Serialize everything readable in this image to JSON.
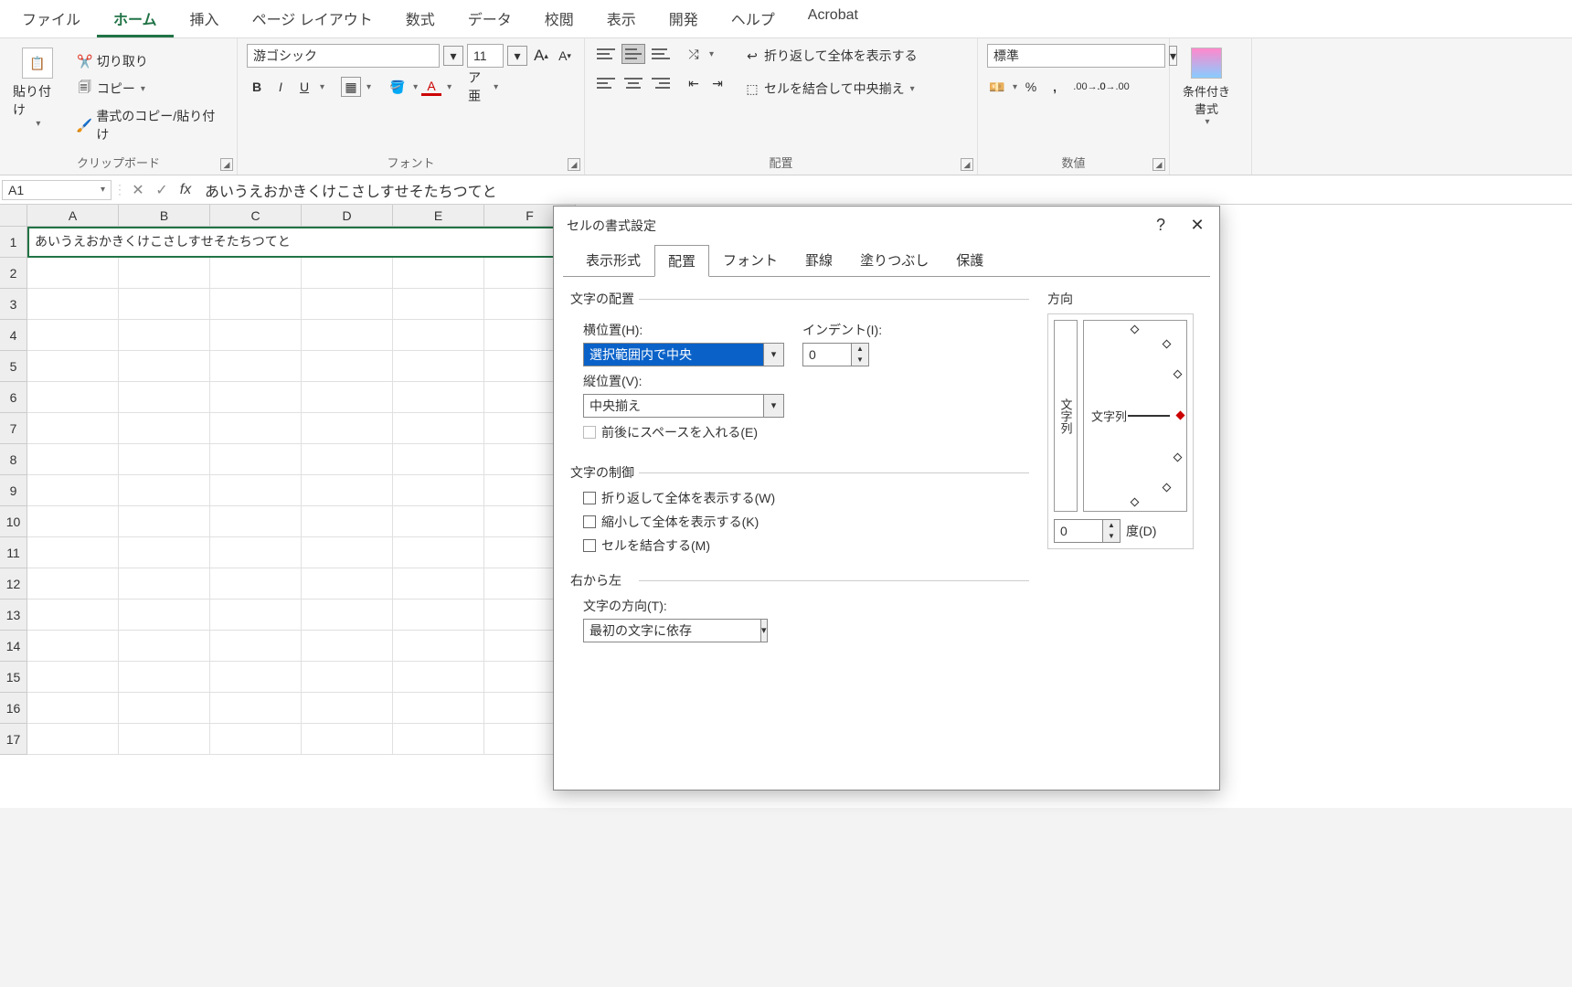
{
  "tabs": [
    "ファイル",
    "ホーム",
    "挿入",
    "ページ レイアウト",
    "数式",
    "データ",
    "校閲",
    "表示",
    "開発",
    "ヘルプ",
    "Acrobat"
  ],
  "activeTab": 1,
  "ribbon": {
    "clipboard": {
      "paste": "貼り付け",
      "cut": "切り取り",
      "copy": "コピー",
      "fmt": "書式のコピー/貼り付け",
      "label": "クリップボード"
    },
    "font": {
      "name": "游ゴシック",
      "size": "11",
      "label": "フォント",
      "bold": "B",
      "italic": "I",
      "underline": "U"
    },
    "align": {
      "wrap": "折り返して全体を表示する",
      "merge": "セルを結合して中央揃え",
      "label": "配置"
    },
    "number": {
      "fmt": "標準",
      "label": "数値"
    },
    "styles": {
      "cfmt": "条件付き\n書式"
    }
  },
  "namebox": "A1",
  "formula": "あいうえおかきくけこさしすせそたちつてと",
  "columns": [
    "A",
    "B",
    "C",
    "D",
    "E",
    "F"
  ],
  "rows": 17,
  "cellA1": "あいうえおかきくけこさしすせそたちつてと",
  "dlg": {
    "title": "セルの書式設定",
    "tabs": [
      "表示形式",
      "配置",
      "フォント",
      "罫線",
      "塗りつぶし",
      "保護"
    ],
    "activeTab": 1,
    "sec_align": "文字の配置",
    "h_label": "横位置(H):",
    "h_value": "選択範囲内で中央",
    "indent_label": "インデント(I):",
    "indent_value": "0",
    "v_label": "縦位置(V):",
    "v_value": "中央揃え",
    "justify": "前後にスペースを入れる(E)",
    "sec_ctrl": "文字の制御",
    "wrap": "折り返して全体を表示する(W)",
    "shrink": "縮小して全体を表示する(K)",
    "merge": "セルを結合する(M)",
    "sec_rtl": "右から左",
    "dir_label": "文字の方向(T):",
    "dir_value": "最初の文字に依存",
    "orient_label": "方向",
    "orient_text": "文字列",
    "orient_vtext": "文字列",
    "deg_value": "0",
    "deg_label": "度(D)",
    "help": "?",
    "close": "✕"
  }
}
